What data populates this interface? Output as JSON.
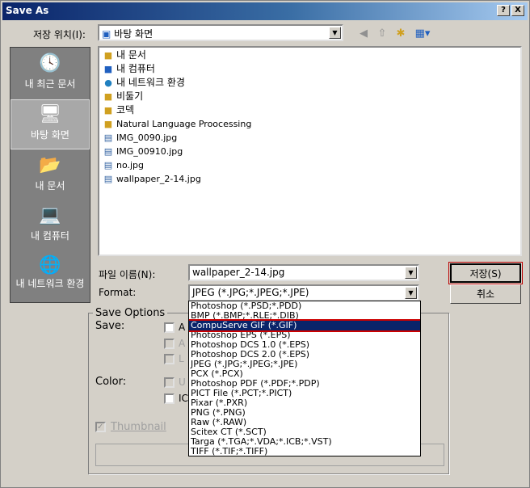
{
  "window": {
    "title": "Save As",
    "help_btn": "?",
    "close_btn": "X"
  },
  "save_in": {
    "label": "저장 위치(I):",
    "value": "바탕 화면"
  },
  "places": [
    {
      "label": "내 최근 문서",
      "icon": "recent-documents-icon"
    },
    {
      "label": "바탕 화면",
      "icon": "desktop-icon"
    },
    {
      "label": "내 문서",
      "icon": "my-documents-icon"
    },
    {
      "label": "내 컴퓨터",
      "icon": "my-computer-icon"
    },
    {
      "label": "내 네트워크 환경",
      "icon": "network-places-icon"
    }
  ],
  "files": [
    {
      "name": "내 문서",
      "icon": "folder-icon"
    },
    {
      "name": "내 컴퓨터",
      "icon": "computer-icon"
    },
    {
      "name": "내 네트워크 환경",
      "icon": "network-icon"
    },
    {
      "name": "비둘기",
      "icon": "folder-icon"
    },
    {
      "name": "코덱",
      "icon": "folder-icon"
    },
    {
      "name": "Natural Language Proocessing",
      "icon": "folder-icon"
    },
    {
      "name": "IMG_0090.jpg",
      "icon": "image-file-icon"
    },
    {
      "name": "IMG_00910.jpg",
      "icon": "image-file-icon"
    },
    {
      "name": "no.jpg",
      "icon": "image-file-icon"
    },
    {
      "name": "wallpaper_2-14.jpg",
      "icon": "image-file-icon"
    }
  ],
  "filename": {
    "label": "파일 이름(N):",
    "value": "wallpaper_2-14.jpg"
  },
  "format": {
    "label": "Format:",
    "value": "JPEG (*.JPG;*.JPEG;*.JPE)"
  },
  "buttons": {
    "save": "저장(S)",
    "cancel": "취소"
  },
  "save_options": {
    "legend": "Save Options",
    "save_label": "Save:",
    "color_label": "Color:",
    "thumbnail": "Thumbnail",
    "partial_a": "A",
    "partial_a2": "A",
    "partial_l": "L",
    "partial_u": "U",
    "partial_ic": "IC"
  },
  "format_options": [
    "Photoshop (*.PSD;*.PDD)",
    "BMP (*.BMP;*.RLE;*.DIB)",
    "CompuServe GIF (*.GIF)",
    "Photoshop EPS (*.EPS)",
    "Photoshop DCS 1.0 (*.EPS)",
    "Photoshop DCS 2.0 (*.EPS)",
    "JPEG (*.JPG;*.JPEG;*.JPE)",
    "PCX (*.PCX)",
    "Photoshop PDF (*.PDF;*.PDP)",
    "PICT File (*.PCT;*.PICT)",
    "Pixar (*.PXR)",
    "PNG (*.PNG)",
    "Raw (*.RAW)",
    "Scitex CT (*.SCT)",
    "Targa (*.TGA;*.VDA;*.ICB;*.VST)",
    "TIFF (*.TIF;*.TIFF)"
  ],
  "highlighted_option": "CompuServe GIF (*.GIF)"
}
